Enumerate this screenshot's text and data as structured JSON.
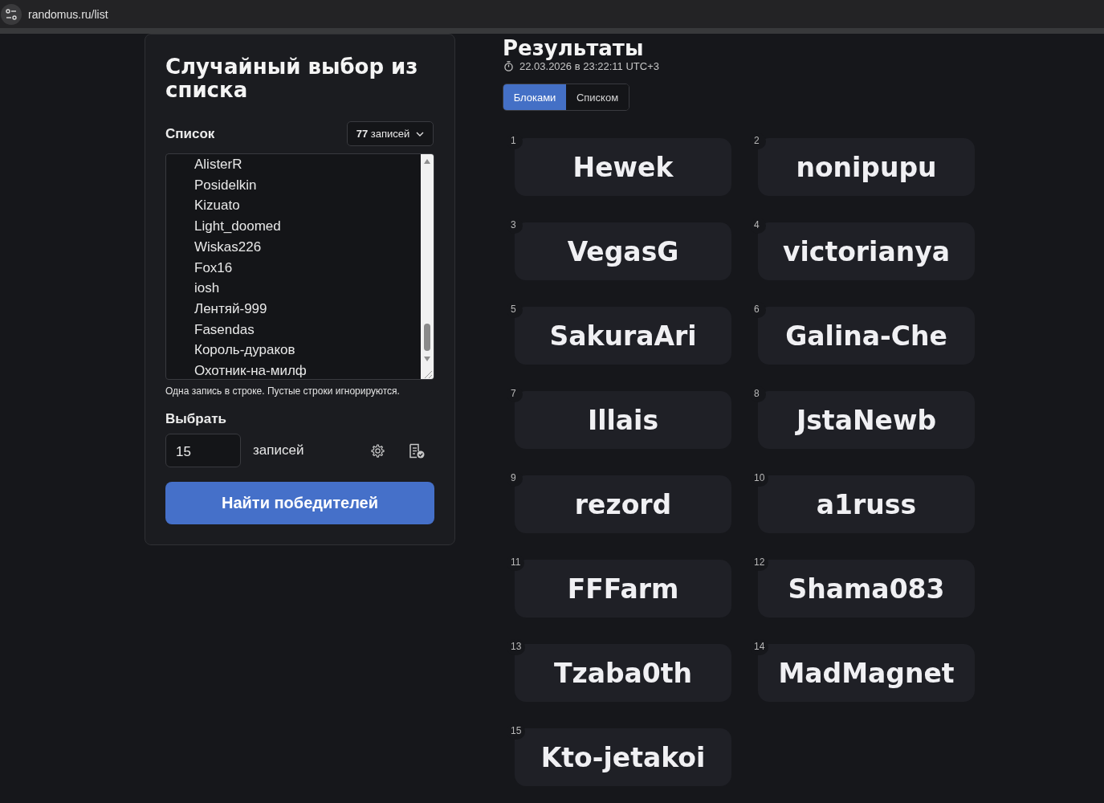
{
  "browser": {
    "url": "randomus.ru/list"
  },
  "picker_form": {
    "title": "Случайный выбор из списка",
    "list_label": "Список",
    "entry_count": "**77** записей",
    "entries": [
      "AlisterR",
      "Posidelkin",
      "Kizuato",
      "Light_doomed",
      "Wiskas226",
      "Fox16",
      "iosh",
      "Лентяй-999",
      "Fasendas",
      "Король-дураков",
      "Охотник-на-милф"
    ],
    "hint": "Одна запись в строке. Пустые строки игнорируются.",
    "pick_label": "Выбрать",
    "pick_count": "15",
    "pick_unit": "записей",
    "submit_button": "Найти победителей"
  },
  "results": {
    "title": "Результаты",
    "timestamp": "22.03.2026 в 23:22:11 UTC+3",
    "view_tabs": [
      {
        "label": "Блоками",
        "selected": true
      },
      {
        "label": "Списком",
        "selected": false
      }
    ],
    "winners": [
      {
        "number": "1",
        "name": "Hewek"
      },
      {
        "number": "2",
        "name": "nonipupu"
      },
      {
        "number": "3",
        "name": "VegasG"
      },
      {
        "number": "4",
        "name": "victorianya"
      },
      {
        "number": "5",
        "name": "SakuraAri"
      },
      {
        "number": "6",
        "name": "Galina-Che"
      },
      {
        "number": "7",
        "name": "Illais"
      },
      {
        "number": "8",
        "name": "JstaNewb"
      },
      {
        "number": "9",
        "name": "rezord"
      },
      {
        "number": "10",
        "name": "a1russ"
      },
      {
        "number": "11",
        "name": "FFFarm"
      },
      {
        "number": "12",
        "name": "Shama083"
      },
      {
        "number": "13",
        "name": "Tzaba0th"
      },
      {
        "number": "14",
        "name": "MadMagnet"
      },
      {
        "number": "15",
        "name": "Kto-jetakoi"
      }
    ]
  }
}
